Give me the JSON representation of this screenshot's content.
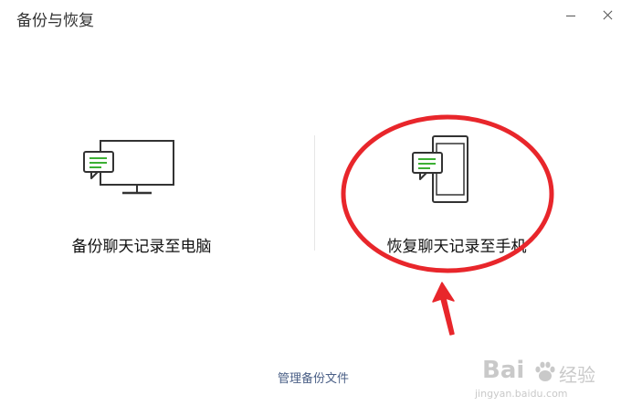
{
  "window": {
    "title": "备份与恢复"
  },
  "options": {
    "backup_to_pc": {
      "label": "备份聊天记录至电脑",
      "icon": "monitor-chat-icon"
    },
    "restore_to_phone": {
      "label": "恢复聊天记录至手机",
      "icon": "phone-chat-icon"
    }
  },
  "footer": {
    "manage_link": "管理备份文件"
  },
  "watermark": {
    "logo": "Bai",
    "logo_suffix": "经验",
    "url": "jingyan.baidu.com"
  },
  "colors": {
    "chat_bubble": "#3cb034",
    "annotation": "#e8262b",
    "link": "#4a5f86"
  }
}
